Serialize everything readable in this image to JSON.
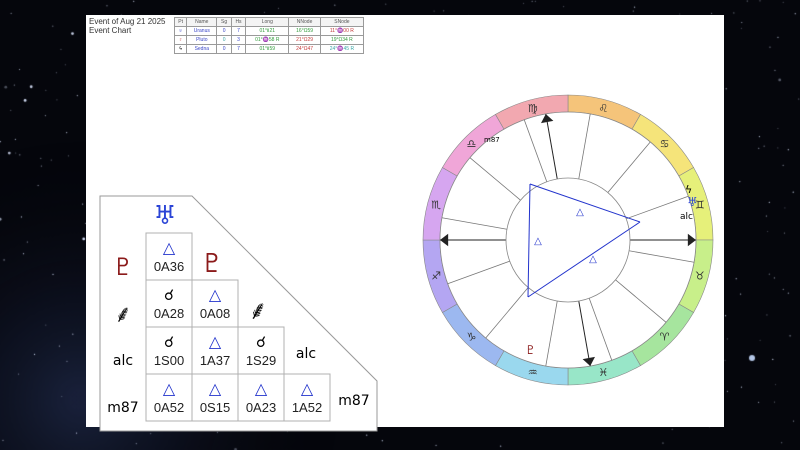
{
  "event": {
    "title": "Event of Aug 21 2025",
    "subtitle": "Event Chart"
  },
  "table": {
    "headers": [
      "Pt",
      "Name",
      "Sg",
      "Hs",
      "Long",
      "NNode",
      "SNode"
    ],
    "rows": [
      {
        "icon": "uranus-icon",
        "glyph": "♅",
        "name": "Uranus",
        "sg": "0",
        "hs": "7",
        "long": "01°Ⅱ21",
        "nnode": "16°Ω59",
        "snode": "11°♒00 R"
      },
      {
        "icon": "pluto-icon",
        "glyph": "♇",
        "name": "Pluto",
        "sg": "0",
        "hs": "3",
        "long": "01°♒58 R",
        "nnode": "21°Ω29",
        "snode": "19°Ω34 R"
      },
      {
        "icon": "sedna-icon",
        "glyph": "ϟ",
        "name": "Sedna",
        "sg": "0",
        "hs": "7",
        "long": "01°Ⅱ59",
        "nnode": "24°Ω47",
        "snode": "24°♒45 R"
      }
    ]
  },
  "aspect_grid": {
    "headers": [
      {
        "label": "♅",
        "icon": "uranus-icon",
        "color": "#2c45d6"
      },
      {
        "label": "♇",
        "icon": "pluto-icon",
        "color": "#8b1a1a"
      },
      {
        "label": "⸙",
        "icon": "sedna-icon",
        "color": "#000000"
      },
      {
        "label": "alc",
        "icon": "",
        "color": "#000000"
      },
      {
        "label": "m87",
        "icon": "",
        "color": "#000000"
      }
    ],
    "cells": [
      {
        "row": 1,
        "col": 0,
        "symbol": "△",
        "kind": "trine",
        "code": "0A36"
      },
      {
        "row": 2,
        "col": 0,
        "symbol": "☌",
        "kind": "conjunction",
        "code": "0A28"
      },
      {
        "row": 2,
        "col": 1,
        "symbol": "△",
        "kind": "trine",
        "code": "0A08"
      },
      {
        "row": 3,
        "col": 0,
        "symbol": "☌",
        "kind": "conjunction",
        "code": "1S00"
      },
      {
        "row": 3,
        "col": 1,
        "symbol": "△",
        "kind": "trine",
        "code": "1A37"
      },
      {
        "row": 3,
        "col": 2,
        "symbol": "☌",
        "kind": "conjunction",
        "code": "1S29"
      },
      {
        "row": 4,
        "col": 0,
        "symbol": "△",
        "kind": "trine",
        "code": "0A52"
      },
      {
        "row": 4,
        "col": 1,
        "symbol": "△",
        "kind": "trine",
        "code": "0S15"
      },
      {
        "row": 4,
        "col": 2,
        "symbol": "△",
        "kind": "trine",
        "code": "0A23"
      },
      {
        "row": 4,
        "col": 3,
        "symbol": "△",
        "kind": "trine",
        "code": "1A52"
      }
    ]
  },
  "wheel": {
    "signs": [
      {
        "glyph": "♌",
        "name": "leo",
        "color": "#f5c47a"
      },
      {
        "glyph": "♋",
        "name": "cancer",
        "color": "#f5e47a"
      },
      {
        "glyph": "♊",
        "name": "gemini",
        "color": "#e6f07a"
      },
      {
        "glyph": "♉",
        "name": "taurus",
        "color": "#c8ef8a"
      },
      {
        "glyph": "♈",
        "name": "aries",
        "color": "#a6e59e"
      },
      {
        "glyph": "♓",
        "name": "pisces",
        "color": "#98e6c8"
      },
      {
        "glyph": "♒",
        "name": "aquarius",
        "color": "#9ad8ee"
      },
      {
        "glyph": "♑",
        "name": "capricorn",
        "color": "#9cb8f0"
      },
      {
        "glyph": "♐",
        "name": "sagittarius",
        "color": "#b4a6f2"
      },
      {
        "glyph": "♏",
        "name": "scorpio",
        "color": "#d6a6f0"
      },
      {
        "glyph": "♎",
        "name": "libra",
        "color": "#f0a6d8"
      },
      {
        "glyph": "♍",
        "name": "virgo",
        "color": "#f2a8b0"
      }
    ],
    "planet_labels": [
      {
        "text": "♅",
        "name": "uranus-marker",
        "color": "#2c45d6"
      },
      {
        "text": "alc",
        "name": "alc-marker",
        "color": "#000000"
      },
      {
        "text": "m87",
        "name": "m87-marker",
        "color": "#000000"
      },
      {
        "text": "♇",
        "name": "pluto-marker",
        "color": "#8b1a1a"
      },
      {
        "text": "ϟ",
        "name": "sedna-marker",
        "color": "#000000"
      }
    ],
    "aspect_color": "#2233cc"
  }
}
